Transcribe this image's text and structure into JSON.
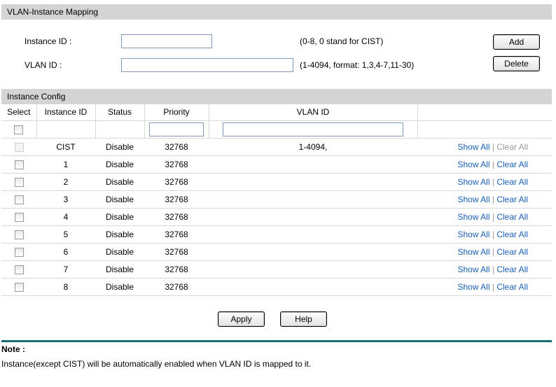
{
  "mapping": {
    "header": "VLAN-Instance Mapping",
    "instance_label": "Instance ID :",
    "instance_value": "",
    "instance_hint": "(0-8, 0 stand for CIST)",
    "vlan_label": "VLAN ID :",
    "vlan_value": "",
    "vlan_hint": "(1-4094, format: 1,3,4-7,11-30)",
    "add_label": "Add",
    "delete_label": "Delete"
  },
  "config": {
    "header": "Instance Config",
    "columns": [
      "Select",
      "Instance ID",
      "Status",
      "Priority",
      "VLAN ID",
      ""
    ],
    "filter_priority": "",
    "filter_vlan": "",
    "show_all": "Show All",
    "separator": "|",
    "clear_all": "Clear All",
    "rows": [
      {
        "id": "CIST",
        "status": "Disable",
        "priority": "32768",
        "vlan": "1-4094,",
        "selectable": false
      },
      {
        "id": "1",
        "status": "Disable",
        "priority": "32768",
        "vlan": "",
        "selectable": true
      },
      {
        "id": "2",
        "status": "Disable",
        "priority": "32768",
        "vlan": "",
        "selectable": true
      },
      {
        "id": "3",
        "status": "Disable",
        "priority": "32768",
        "vlan": "",
        "selectable": true
      },
      {
        "id": "4",
        "status": "Disable",
        "priority": "32768",
        "vlan": "",
        "selectable": true
      },
      {
        "id": "5",
        "status": "Disable",
        "priority": "32768",
        "vlan": "",
        "selectable": true
      },
      {
        "id": "6",
        "status": "Disable",
        "priority": "32768",
        "vlan": "",
        "selectable": true
      },
      {
        "id": "7",
        "status": "Disable",
        "priority": "32768",
        "vlan": "",
        "selectable": true
      },
      {
        "id": "8",
        "status": "Disable",
        "priority": "32768",
        "vlan": "",
        "selectable": true
      }
    ]
  },
  "actions": {
    "apply_label": "Apply",
    "help_label": "Help"
  },
  "note": {
    "title": "Note :",
    "text": "Instance(except CIST) will be automatically enabled when VLAN ID is mapped to it."
  },
  "colors": {
    "header_bg": "#d4d4d4",
    "link": "#1a5fb4",
    "link_disabled": "#9a9a9a",
    "note_rule": "#1a6e70"
  }
}
